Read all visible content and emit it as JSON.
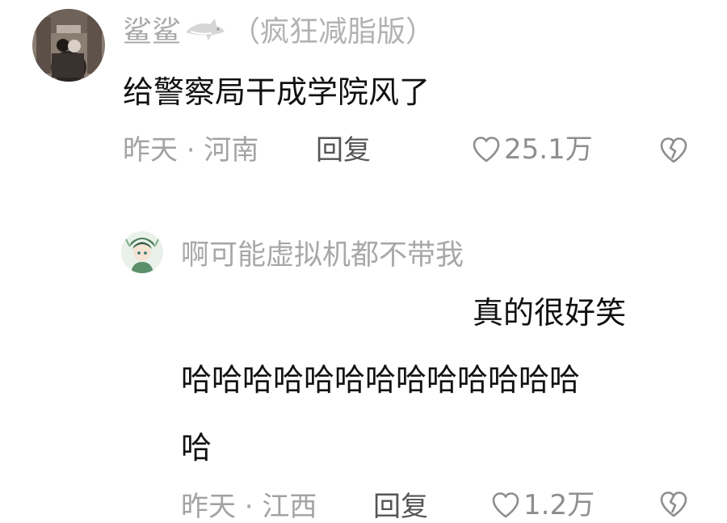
{
  "comments": [
    {
      "username": "鲨鲨",
      "username_suffix": "（疯狂减脂版）",
      "badge_icon": "shark-icon",
      "text": "给警察局干成学院风了",
      "time": "昨天 · 河南",
      "reply_label": "回复",
      "like_count": "25.1万"
    },
    {
      "username": "啊可能虚拟机都不带我",
      "text_line1": "真的很好笑",
      "text_line2": "哈哈哈哈哈哈哈哈哈哈哈哈哈",
      "text_line3": "哈",
      "time": "昨天 · 江西",
      "reply_label": "回复",
      "like_count": "1.2万"
    }
  ],
  "colors": {
    "username": "#a8a8a8",
    "content": "#111111",
    "meta": "#a3a3a3",
    "reply": "#555555"
  }
}
